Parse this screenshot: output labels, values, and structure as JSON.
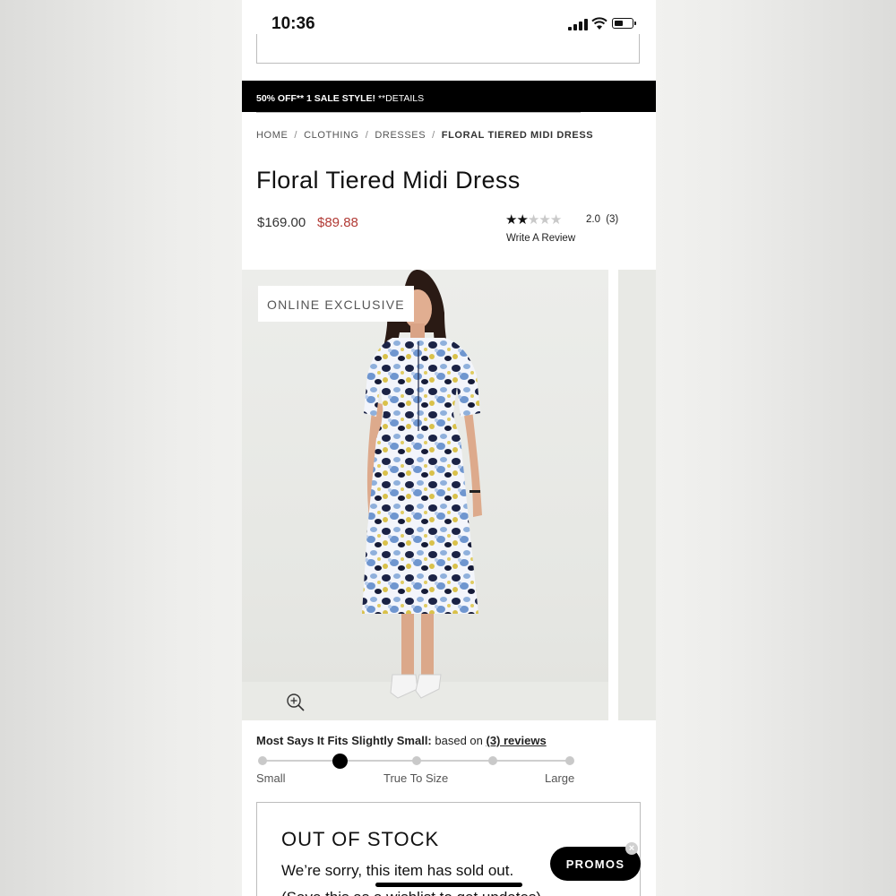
{
  "status_bar": {
    "time": "10:36"
  },
  "promo_bar": {
    "bold": "50% OFF** 1 SALE STYLE!",
    "details": " **DETAILS"
  },
  "breadcrumb": {
    "items": [
      "HOME",
      "CLOTHING",
      "DRESSES"
    ],
    "current": "FLORAL TIERED MIDI DRESS",
    "separator": "/"
  },
  "product": {
    "title": "Floral Tiered Midi Dress",
    "original_price": "$169.00",
    "sale_price": "$89.88",
    "rating_value": 2.0,
    "rating_max": 5,
    "rating_text": "2.0",
    "review_count": "(3)",
    "write_review": "Write A Review",
    "image_badge": "ONLINE EXCLUSIVE"
  },
  "fit": {
    "summary_bold": "Most Says It Fits Slightly Small:",
    "summary_rest": " based on ",
    "reviews_link": "(3) reviews",
    "labels": {
      "small": "Small",
      "true": "True To Size",
      "large": "Large"
    },
    "positions": 5,
    "selected_index": 1
  },
  "stock": {
    "title": "OUT OF STOCK",
    "message": "We’re sorry, this item has sold out.",
    "message2": "(Save this as a wishlist to get updates)"
  },
  "promos_button": "PROMOS",
  "icons": {
    "zoom": "zoom-in-icon",
    "close": "close-icon"
  },
  "colors": {
    "sale_price": "#b13a35",
    "promo_bar": "#000000"
  }
}
